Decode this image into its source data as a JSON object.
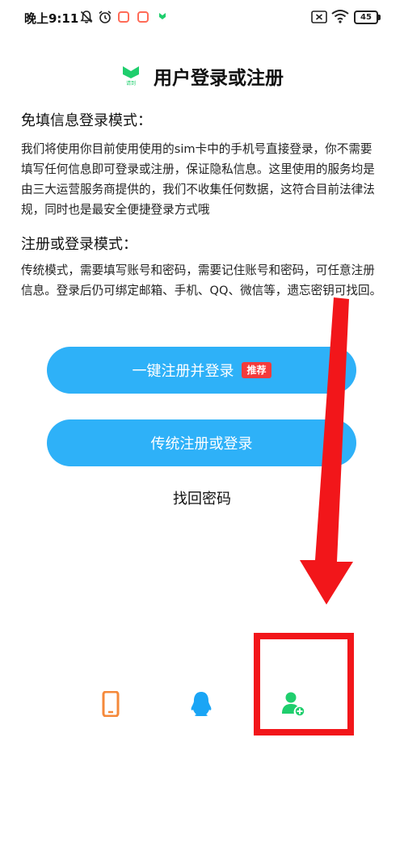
{
  "status_bar": {
    "time": "晚上9:11",
    "battery": "45"
  },
  "header": {
    "logo_text": "请到",
    "title": "用户登录或注册"
  },
  "sections": [
    {
      "heading": "免填信息登录模式：",
      "text": "我们将使用你目前使用使用的sim卡中的手机号直接登录，你不需要填写任何信息即可登录或注册，保证隐私信息。这里使用的服务均是由三大运营服务商提供的，我们不收集任何数据，这符合目前法律法规，同时也是最安全便捷登录方式哦"
    },
    {
      "heading": "注册或登录模式：",
      "text": "传统模式，需要填写账号和密码，需要记住账号和密码，可任意注册信息。登录后仍可绑定邮箱、手机、QQ、微信等，遗忘密钥可找回。"
    }
  ],
  "buttons": {
    "one_click_label": "一键注册并登录",
    "one_click_badge": "推荐",
    "traditional_label": "传统注册或登录"
  },
  "forgot_password": "找回密码",
  "colors": {
    "primary_button": "#2eb1f8",
    "badge": "#f43b3b",
    "annotation_red": "#f2161a",
    "phone_icon": "#f5893a",
    "qq_icon": "#1aa5f5",
    "register_icon": "#1fce6d"
  },
  "login_methods": [
    {
      "icon": "phone-icon"
    },
    {
      "icon": "qq-icon"
    },
    {
      "icon": "add-user-icon"
    }
  ]
}
